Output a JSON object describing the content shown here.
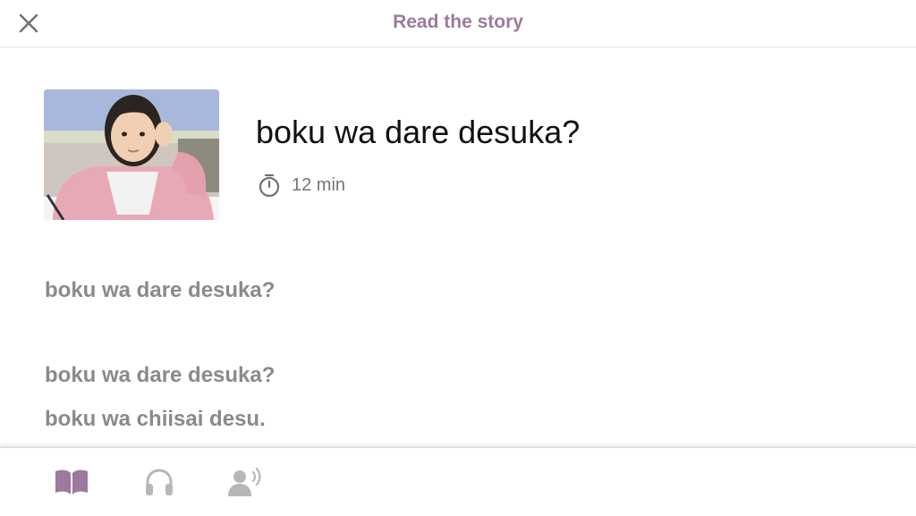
{
  "header": {
    "title": "Read the story",
    "close_icon": "close-icon"
  },
  "story": {
    "title": "boku wa dare desuka?",
    "duration": "12 min",
    "thumbnail": "girl-thinking-photo",
    "lines": [
      "boku wa dare desuka?",
      "boku wa dare desuka?",
      "boku wa chiisai desu."
    ]
  },
  "bottom_nav": {
    "tabs": [
      {
        "icon": "book-icon",
        "active": true
      },
      {
        "icon": "headphones-icon",
        "active": false
      },
      {
        "icon": "speaker-icon",
        "active": false
      }
    ]
  },
  "colors": {
    "accent": "#9c7a9c",
    "inactive_icon": "#b7b7b7",
    "body_text": "#8a8a8a",
    "title_text": "#111111"
  }
}
